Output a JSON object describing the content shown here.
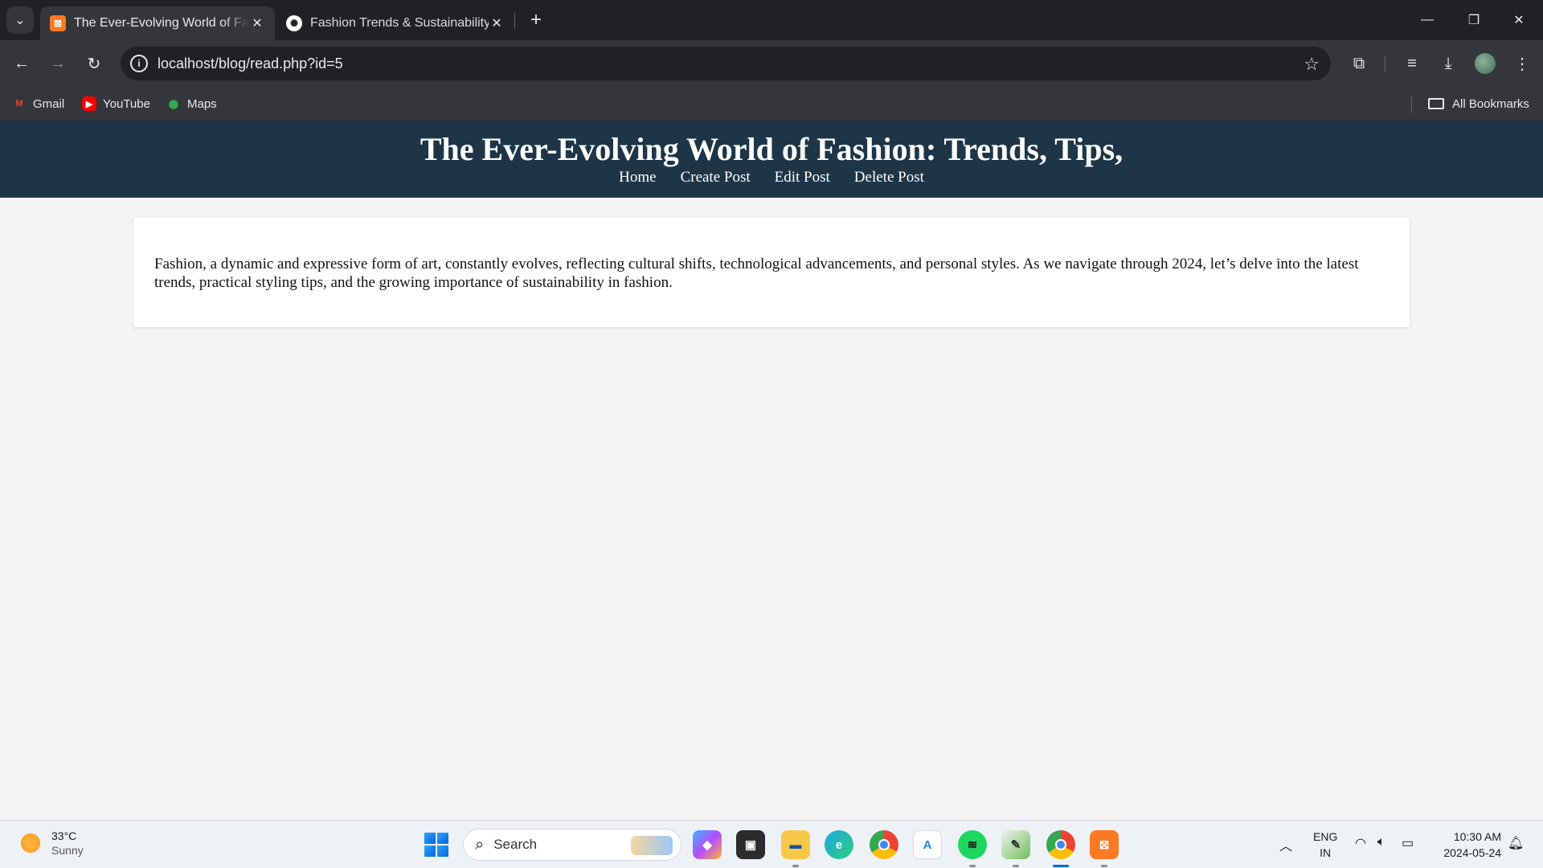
{
  "browser": {
    "tabs": [
      {
        "title": "The Ever-Evolving World of Fashion: Trends, Tips,",
        "active": true
      },
      {
        "title": "Fashion Trends & Sustainability",
        "active": false
      }
    ],
    "url": "localhost/blog/read.php?id=5",
    "bookmarks": [
      {
        "label": "Gmail"
      },
      {
        "label": "YouTube"
      },
      {
        "label": "Maps"
      }
    ],
    "all_bookmarks_label": "All Bookmarks"
  },
  "page": {
    "title": "The Ever-Evolving World of Fashion: Trends, Tips,",
    "nav": [
      "Home",
      "Create Post",
      "Edit Post",
      "Delete Post"
    ],
    "post_body": "Fashion, a dynamic and expressive form of art, constantly evolves, reflecting cultural shifts, technological advancements, and personal styles. As we navigate through 2024, let’s delve into the latest trends, practical styling tips, and the growing importance of sustainability in fashion."
  },
  "taskbar": {
    "weather": {
      "temp": "33°C",
      "condition": "Sunny"
    },
    "search_placeholder": "Search",
    "language": {
      "line1": "ENG",
      "line2": "IN"
    },
    "clock": {
      "time": "10:30 AM",
      "date": "2024-05-24"
    },
    "apps": [
      "copilot",
      "task-view",
      "file-explorer",
      "edge",
      "chrome",
      "app-store",
      "spotify",
      "notepad",
      "chrome-active",
      "xampp"
    ]
  },
  "colors": {
    "header_bg": "#1d3547",
    "page_bg": "#f4f4f4",
    "chrome_dark": "#202124",
    "chrome_toolbar": "#35363a"
  }
}
